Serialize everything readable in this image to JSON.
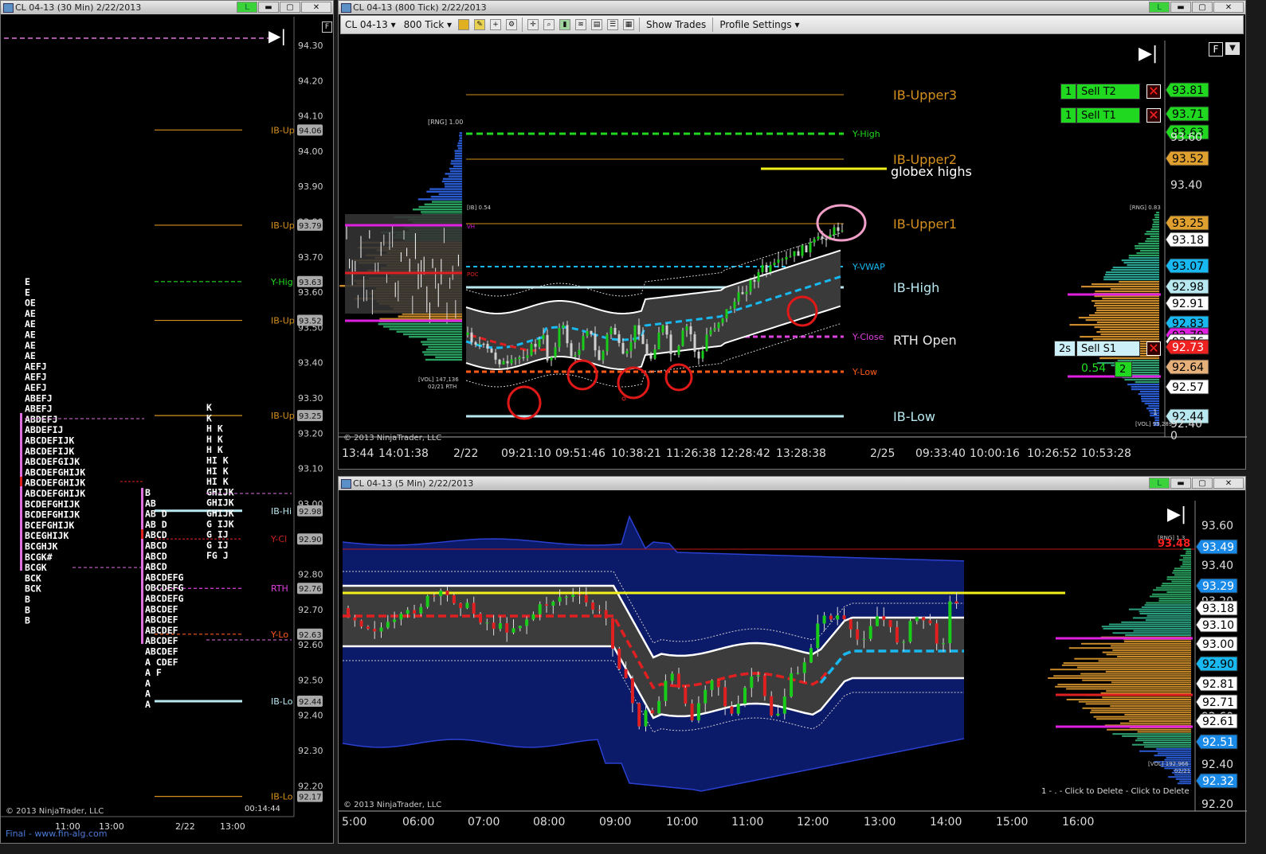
{
  "windows": {
    "left": {
      "title": "CL 04-13 (30 Min)  2/22/2013",
      "btn_l": "L",
      "btn_min": "▬",
      "btn_max": "▢",
      "btn_close": "✕",
      "f_box": "F",
      "price_labels": [
        "94.30",
        "94.20",
        "94.10",
        "94.00",
        "93.90",
        "93.80",
        "93.70",
        "93.60",
        "93.50",
        "93.40",
        "93.30",
        "93.20",
        "93.10",
        "93.00",
        "92.90",
        "92.80",
        "92.70",
        "92.60",
        "92.50",
        "92.40",
        "92.30",
        "92.20"
      ],
      "tags": [
        "94.06",
        "93.79",
        "93.63",
        "93.52",
        "93.25",
        "92.98",
        "92.90",
        "92.76",
        "92.63",
        "92.44",
        "92.17"
      ],
      "level_labels": [
        "IB-Up",
        "IB-Up",
        "Y-Hig",
        "IB-Up",
        "IB-Up",
        "IB-Hi",
        "Y-Cl",
        "RTH",
        "Y-Lo",
        "IB-Lo",
        "IB-Lo"
      ],
      "x_labels": [
        "11:00",
        "13:00",
        "2/22",
        "13:00"
      ],
      "copyright": "© 2013 NinjaTrader, LLC",
      "clock": "00:14:44",
      "footer_link": "Final - www.fin-alg.com",
      "tpo_main": [
        "E",
        "E",
        "OE",
        "AE",
        "AE",
        "AE",
        "AE",
        "AE",
        "AEFJ",
        "AEFJ",
        "AEFJ",
        "ABEFJ",
        "ABEFJ",
        "ABDEFJ",
        "ABDEFIJ",
        "ABCDEFIJK",
        "ABCDEFIJK",
        "ABCDEFGIJK",
        "ABCDEFGHIJK",
        "ABCDEFGHIJK",
        "ABCDEFGHIJK",
        "BCDEFGHIJK",
        "BCDEFGHIJK",
        "BCEFGHIJK",
        "BCEGHIJK",
        "BCGHJK",
        "BCGK#",
        "BCGK",
        "BCK",
        "BCK",
        "B",
        "B",
        "B"
      ],
      "tpo_second": [
        "B",
        "AB",
        "AB D",
        "AB D",
        "ABCD",
        "ABCD",
        "ABCD",
        "ABCD",
        "ABCDEFG",
        "OBCDEFG",
        "ABCDEFG",
        "ABCDEF",
        "ABCDEF",
        "ABCDEF",
        "ABCDEF",
        "ABCDEF",
        "A CDEF",
        "A      F",
        "A",
        "A",
        "A"
      ],
      "tpo_third": [
        "K",
        "K",
        "H K",
        "H K",
        "H K",
        "HI K",
        "HI K",
        "HI K",
        "GHIJK",
        "GHIJK",
        "GHIJK",
        "G  IJK",
        "G  IJ",
        "G  IJ",
        "FG  J"
      ]
    },
    "top": {
      "title": "CL 04-13 (800 Tick)  2/22/2013",
      "btn_l": "L",
      "btn_min": "▬",
      "btn_max": "▢",
      "btn_close": "✕",
      "toolbar": {
        "instrument": "CL 04-13",
        "period": "800 Tick",
        "show_trades": "Show Trades",
        "profile_settings": "Profile Settings"
      },
      "f_box": "F",
      "annotations": {
        "ib_upper3": "IB-Upper3",
        "ib_upper2": "IB-Upper2",
        "globex_highs": "globex highs",
        "ib_upper1": "IB-Upper1",
        "ib_high": "IB-High",
        "rth_open": "RTH Open",
        "ib_low": "IB-Low",
        "y_high": "Y-High",
        "y_vwap": "Y-VWAP",
        "y_close": "Y-Close",
        "y_low": "Y-Low",
        "rng_left": "[RNG] 1.00",
        "ib_val": "[IB] 0.54",
        "vol_left": "[VOL] 147,136",
        "vol_left_date": "02/21 RTH",
        "vh": "VH",
        "poc": "POC",
        "rng_right": "[RNG] 0.83",
        "vol_right": "[VOL] 99,289",
        "one": "1"
      },
      "orders": {
        "sell_t2_qty": "1",
        "sell_t2": "Sell T2",
        "sell_t1_qty": "1",
        "sell_t1": "Sell T1",
        "sell_s1_qty": "2s",
        "sell_s1": "Sell S1",
        "pnl": "0.54",
        "pos": "2"
      },
      "price_tags": [
        "93.81",
        "93.71",
        "93.63",
        "93.52",
        "93.25",
        "93.18",
        "93.07",
        "92.98",
        "92.91",
        "92.83",
        "92.79",
        "92.76",
        "92.73",
        "92.64",
        "92.57",
        "92.44"
      ],
      "axis_labels": [
        "93.60",
        "93.40",
        "92.40",
        "0"
      ],
      "x_labels": [
        "13:44",
        "14:01:38",
        "2/22",
        "09:21:10",
        "09:51:46",
        "10:38:21",
        "11:26:38",
        "12:28:42",
        "13:28:38",
        "2/25",
        "09:33:40",
        "10:00:16",
        "10:26:52",
        "10:53:28"
      ],
      "copyright": "© 2013 NinjaTrader, LLC"
    },
    "bottom": {
      "title": "CL 04-13 (5 Min)  2/22/2013",
      "btn_l": "L",
      "btn_min": "▬",
      "btn_max": "▢",
      "btn_close": "✕",
      "axis_labels": [
        "93.60",
        "93.40",
        "93.20",
        "93.00",
        "92.80",
        "92.60",
        "92.40",
        "92.20"
      ],
      "price_tags": [
        "93.49",
        "93.29",
        "93.18",
        "93.10",
        "93.00",
        "92.90",
        "92.81",
        "92.71",
        "92.61",
        "92.51",
        "92.32"
      ],
      "red_price": "93.48",
      "rng_label": "[RNG] 1.3",
      "vol_label": "[VOL] 192,966",
      "vol_date": "02/21",
      "x_labels": [
        "5:00",
        "06:00",
        "07:00",
        "08:00",
        "09:00",
        "10:00",
        "11:00",
        "12:00",
        "13:00",
        "14:00",
        "15:00",
        "16:00"
      ],
      "copyright": "© 2013 NinjaTrader, LLC",
      "delete_hint": "1 - . - Click to Delete - Click to Delete"
    }
  },
  "colors": {
    "ib_orange": "#d4901c",
    "yhigh_green": "#20d820",
    "vwap_cyan": "#18b8f0",
    "yclose_magenta": "#e040e0",
    "ylow_orange": "#ff5a1a",
    "ib_light": "#b8e8f0",
    "globex_yellow": "#f2f21a",
    "vwap_red": "#e02020",
    "band_blue": "#0c1a6a"
  }
}
